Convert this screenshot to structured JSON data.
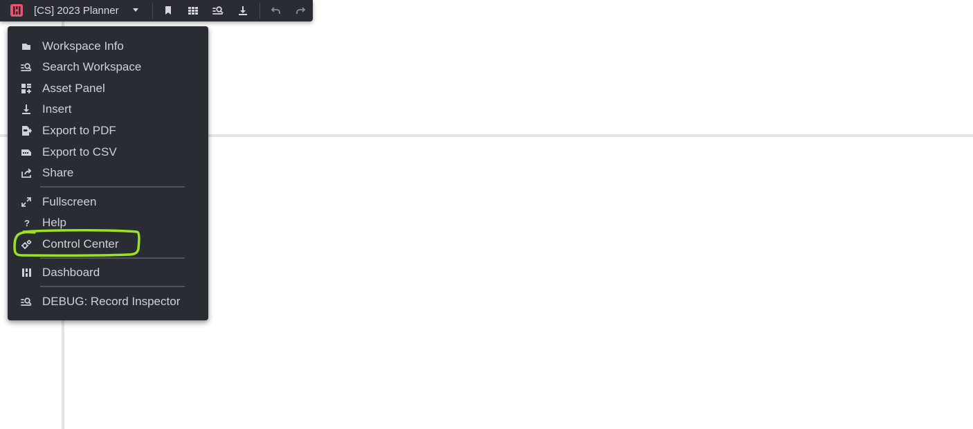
{
  "toolbar": {
    "workspace_title": "[CS] 2023 Planner",
    "icons": [
      "app-logo",
      "bookmark-icon",
      "grid-icon",
      "search-records-icon",
      "download-icon",
      "undo-icon",
      "redo-icon"
    ]
  },
  "menu": {
    "items": [
      {
        "label": "Workspace Info",
        "icon": "folder-icon"
      },
      {
        "label": "Search Workspace",
        "icon": "search-records-icon"
      },
      {
        "label": "Asset Panel",
        "icon": "asset-panel-icon"
      },
      {
        "label": "Insert",
        "icon": "insert-icon"
      },
      {
        "label": "Export to PDF",
        "icon": "export-pdf-icon"
      },
      {
        "label": "Export to CSV",
        "icon": "export-csv-icon"
      },
      {
        "label": "Share",
        "icon": "share-icon"
      },
      {
        "label": "Fullscreen",
        "icon": "fullscreen-icon"
      },
      {
        "label": "Help",
        "icon": "help-icon"
      },
      {
        "label": "Control Center",
        "icon": "gears-icon"
      },
      {
        "label": "Dashboard",
        "icon": "dashboard-icon"
      },
      {
        "label": "DEBUG: Record Inspector",
        "icon": "search-records-icon"
      }
    ]
  },
  "colors": {
    "menu_bg": "#2a2c33",
    "menu_text": "#cfd1d8",
    "logo_accent": "#e8556d",
    "highlight": "#9be21f"
  }
}
